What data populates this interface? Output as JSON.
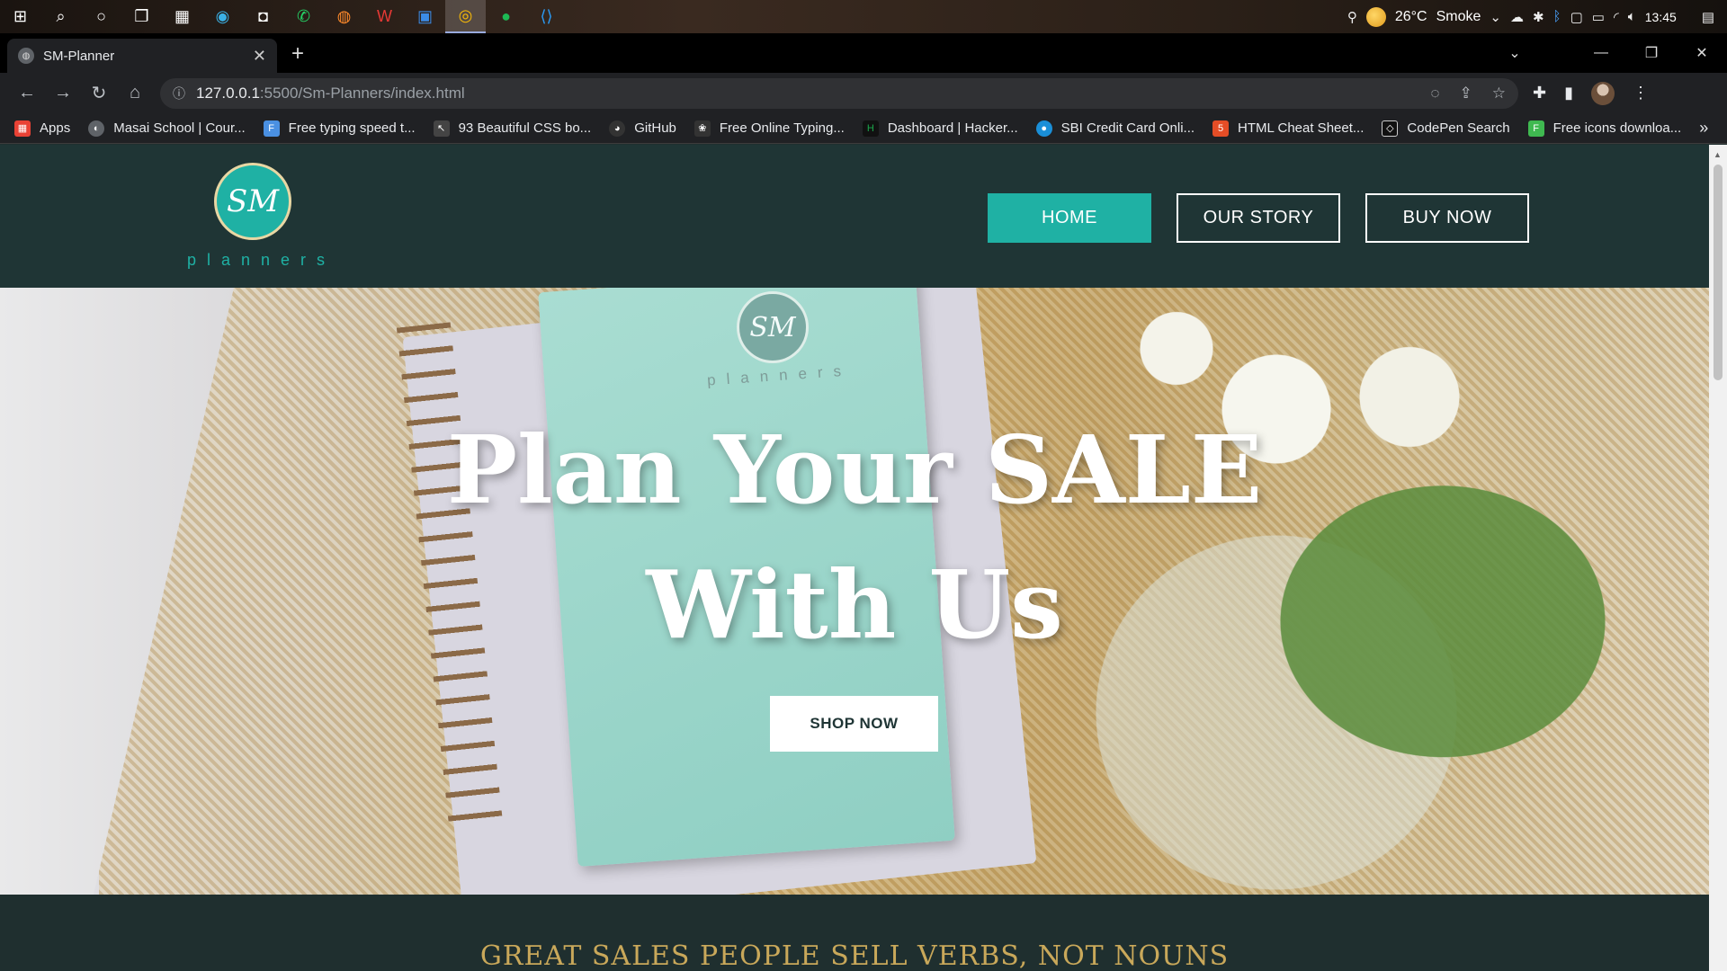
{
  "taskbar": {
    "weather_temp": "26°C",
    "weather_desc": "Smoke",
    "time": "13:45"
  },
  "browser": {
    "tab_title": "SM-Planner",
    "url_host": "127.0.0.1",
    "url_path": ":5500/Sm-Planners/index.html",
    "bookmarks": [
      {
        "label": "Apps",
        "icon": "apps-grid-icon",
        "color": "#e94235"
      },
      {
        "label": "Masai School | Cour...",
        "icon": "masai-icon",
        "color": "#5f6368"
      },
      {
        "label": "Free typing speed t...",
        "icon": "typing-icon",
        "color": "#4a90e2"
      },
      {
        "label": "93 Beautiful CSS bo...",
        "icon": "cursor-icon",
        "color": "#444"
      },
      {
        "label": "GitHub",
        "icon": "github-icon",
        "color": "#333"
      },
      {
        "label": "Free Online Typing...",
        "icon": "paw-icon",
        "color": "#333"
      },
      {
        "label": "Dashboard | Hacker...",
        "icon": "hackerrank-icon",
        "color": "#1ba94c"
      },
      {
        "label": "SBI Credit Card Onli...",
        "icon": "sbi-icon",
        "color": "#1a8fd8"
      },
      {
        "label": "HTML Cheat Sheet...",
        "icon": "html5-icon",
        "color": "#e44d26"
      },
      {
        "label": "CodePen Search",
        "icon": "codepen-icon",
        "color": "#111"
      },
      {
        "label": "Free icons downloa...",
        "icon": "flaticon-icon",
        "color": "#3fb950"
      }
    ]
  },
  "site": {
    "logo_monogram": "SM",
    "logo_text": "planners",
    "nav": [
      {
        "label": "HOME",
        "active": true
      },
      {
        "label": "OUR STORY",
        "active": false
      },
      {
        "label": "BUY NOW",
        "active": false
      }
    ],
    "hero": {
      "title_line1": "Plan Your SALE",
      "title_line2": "With Us",
      "cta": "SHOP NOW",
      "photo_monogram": "SM",
      "photo_text": "planners"
    },
    "tagline": "GREAT SALES PEOPLE SELL VERBS, NOT NOUNS",
    "colors": {
      "header_bg": "#1f3535",
      "accent": "#1fb1a4",
      "gold": "#c9a85a"
    }
  }
}
